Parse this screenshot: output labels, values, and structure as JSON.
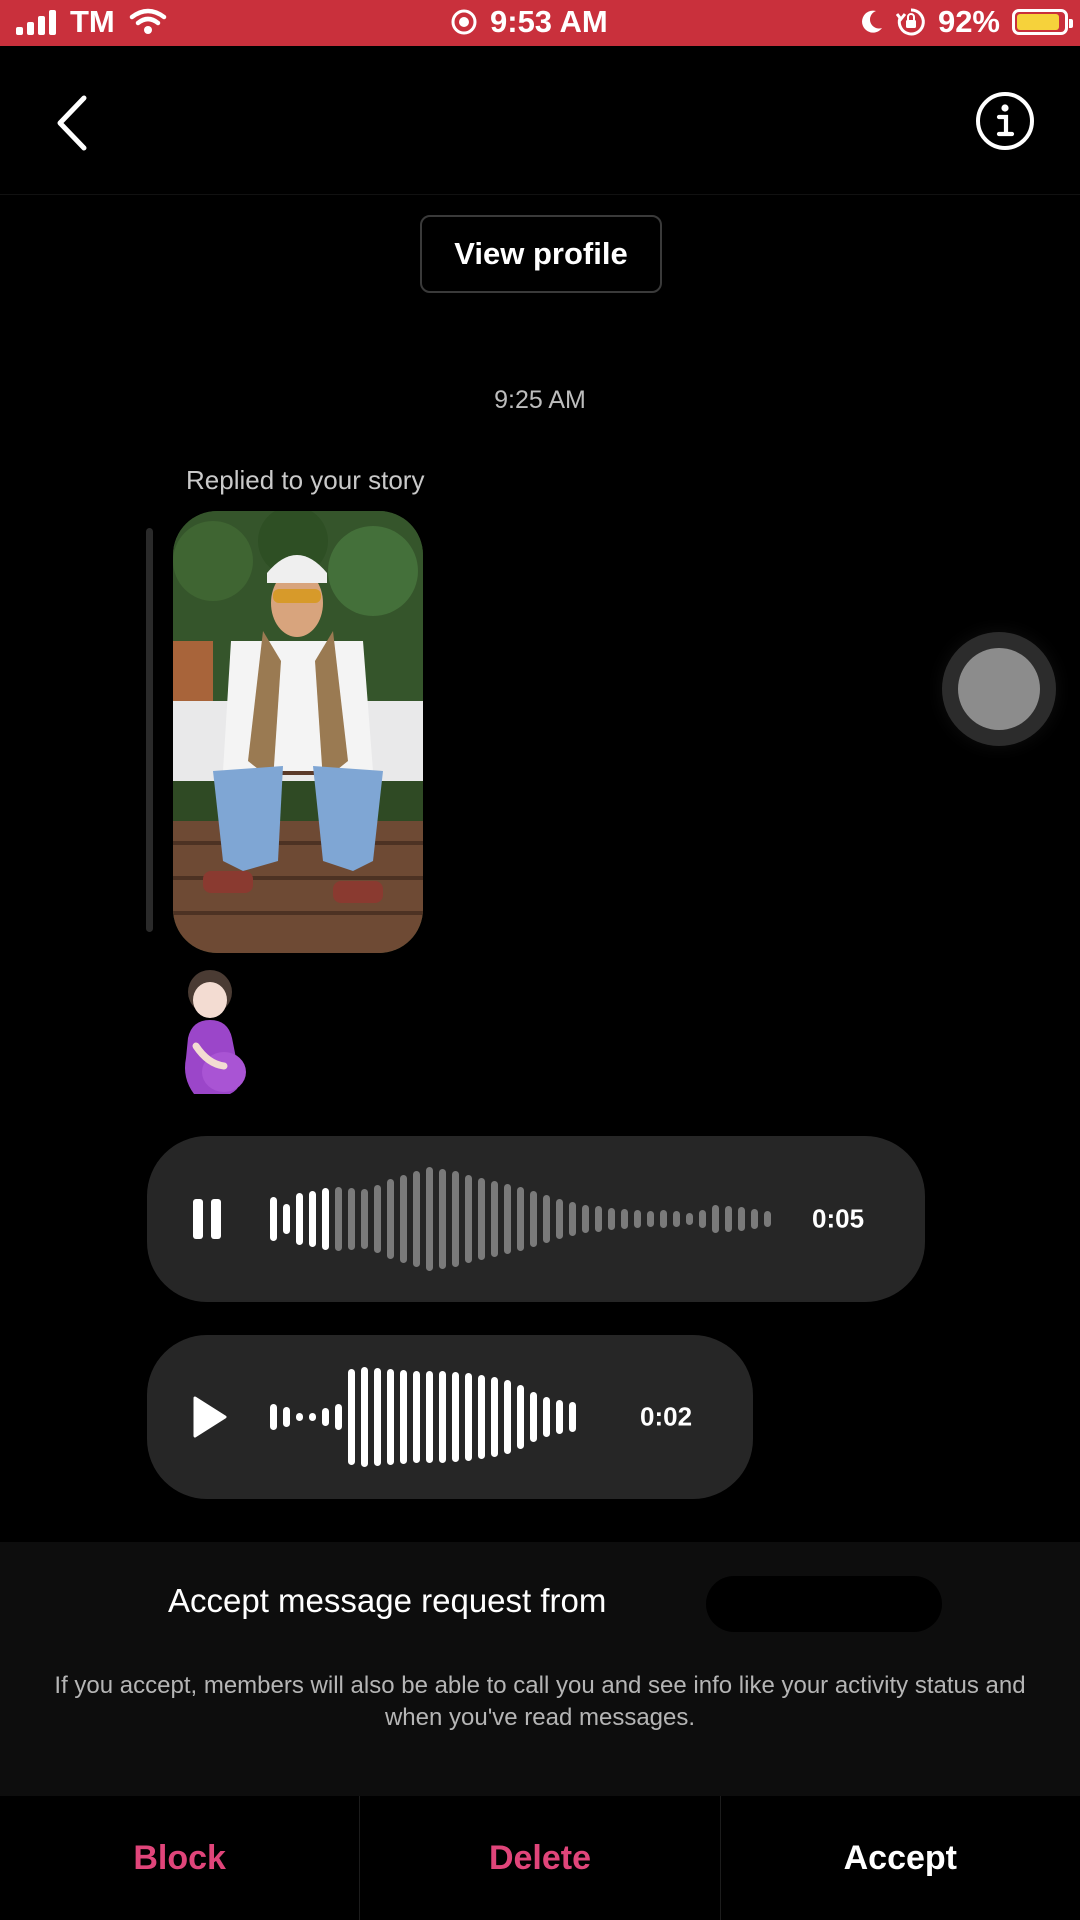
{
  "status_bar": {
    "carrier": "TM",
    "time": "9:53 AM",
    "battery_percent": "92%",
    "battery_level": 0.92,
    "icons": [
      "signal-icon",
      "wifi-icon",
      "location-icon",
      "moon-icon",
      "orientation-lock-icon",
      "battery-icon"
    ],
    "bg_color": "#c9303c"
  },
  "header": {
    "back_icon": "chevron-left-icon",
    "info_icon": "info-icon"
  },
  "view_profile_label": "View profile",
  "messages": {
    "timestamp": "9:25 AM",
    "replied_label": "Replied to your story",
    "story_image": "photo of a man in cap and sunglasses sitting on steps",
    "emoji": "pregnant-woman-emoji",
    "voice_messages": [
      {
        "state": "playing",
        "control_icon": "pause-icon",
        "duration": "0:05"
      },
      {
        "state": "paused",
        "control_icon": "play-icon",
        "duration": "0:02"
      }
    ]
  },
  "request": {
    "title": "Accept message request from",
    "description": "If you accept, members will also be able to call you and see info like your activity status and when you've read messages."
  },
  "actions": {
    "block": "Block",
    "delete": "Delete",
    "accept": "Accept",
    "destructive_color": "#e0457a",
    "primary_color": "#ffffff"
  }
}
